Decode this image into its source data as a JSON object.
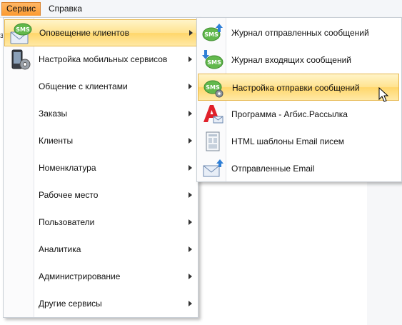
{
  "menubar": {
    "items": [
      {
        "label": "Сервис",
        "active": true
      },
      {
        "label": "Справка",
        "active": false
      }
    ],
    "edge_text": "з"
  },
  "menu": {
    "items": [
      {
        "label": "Оповещение клиентов",
        "icon": "sms-mail-icon",
        "has_submenu": true,
        "highlighted": true
      },
      {
        "label": "Настройка мобильных сервисов",
        "icon": "phone-gear-icon",
        "has_submenu": true
      },
      {
        "label": "Общение с клиентами",
        "has_submenu": true
      },
      {
        "label": "Заказы",
        "has_submenu": true
      },
      {
        "label": "Клиенты",
        "has_submenu": true
      },
      {
        "label": "Номенклатура",
        "has_submenu": true
      },
      {
        "label": "Рабочее место",
        "has_submenu": true
      },
      {
        "label": "Пользователи",
        "has_submenu": true
      },
      {
        "label": "Аналитика",
        "has_submenu": true
      },
      {
        "label": "Администрирование",
        "has_submenu": true
      },
      {
        "label": "Другие сервисы",
        "has_submenu": true
      }
    ]
  },
  "submenu": {
    "items": [
      {
        "label": "Журнал отправленных сообщений",
        "icon": "sms-upload-icon"
      },
      {
        "label": "Журнал входящих сообщений",
        "icon": "sms-download-icon"
      },
      {
        "label": "Настройка отправки сообщений",
        "icon": "sms-settings-icon",
        "highlighted": true
      },
      {
        "label": "Программа - Агбис.Рассылка",
        "icon": "agbis-mail-icon"
      },
      {
        "label": "HTML шаблоны Email писем",
        "icon": "html-template-icon"
      },
      {
        "label": "Отправленные Email",
        "icon": "email-sent-icon"
      }
    ]
  },
  "colors": {
    "menu_highlight": "#ffe38f",
    "menubar_active": "#fb9a30",
    "sms_bubble": "#5fb84a",
    "accent_red": "#e0202a",
    "arrow_blue": "#2f7fd6"
  }
}
